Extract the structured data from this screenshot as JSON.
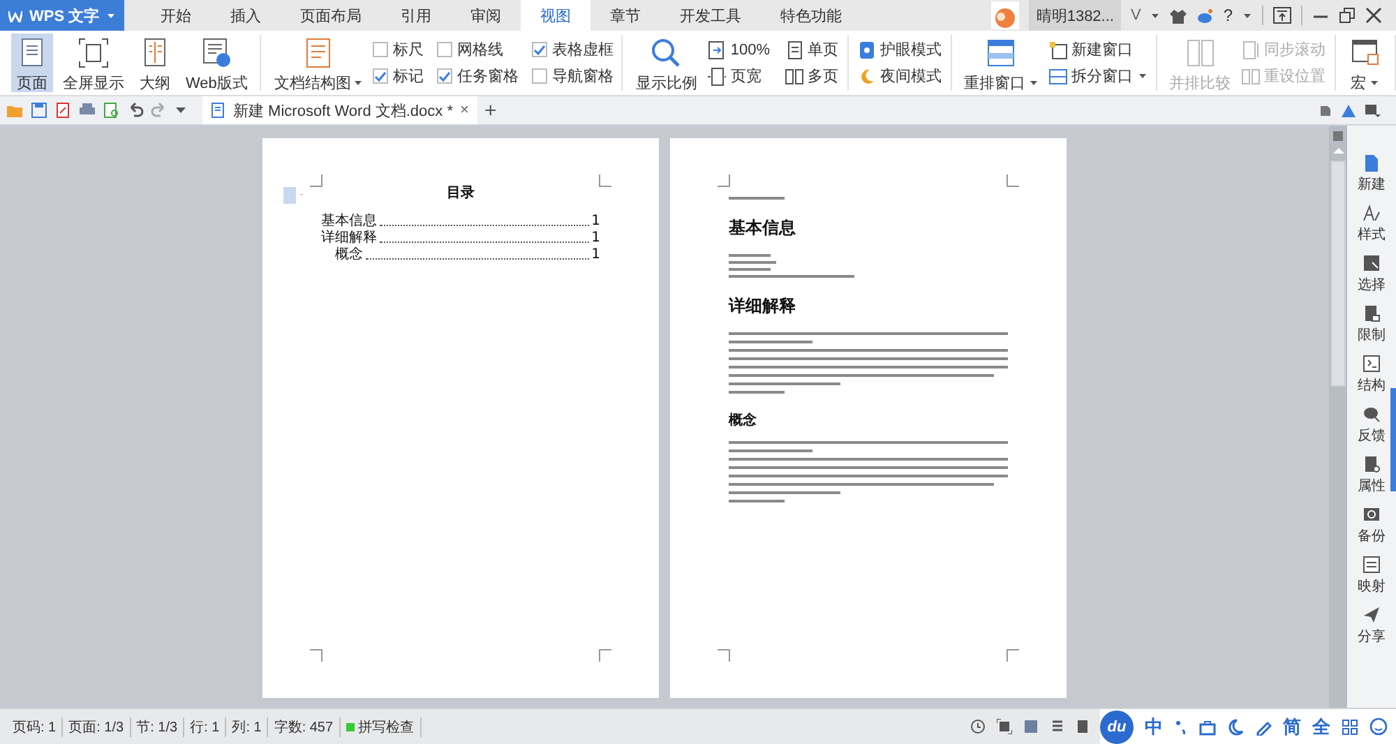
{
  "app_menu": {
    "label": "WPS 文字"
  },
  "tabs": [
    {
      "label": "开始",
      "selected": false
    },
    {
      "label": "插入",
      "selected": false
    },
    {
      "label": "页面布局",
      "selected": false
    },
    {
      "label": "引用",
      "selected": false
    },
    {
      "label": "审阅",
      "selected": false
    },
    {
      "label": "视图",
      "selected": true
    },
    {
      "label": "章节",
      "selected": false
    },
    {
      "label": "开发工具",
      "selected": false
    },
    {
      "label": "特色功能",
      "selected": false
    }
  ],
  "user": {
    "name": "晴明1382...",
    "badge": "V",
    "help": "?"
  },
  "ribbon": {
    "groups": [
      {
        "disabled": false,
        "items": [
          {
            "kind": "large",
            "label": "页面",
            "selected": true
          },
          {
            "kind": "large",
            "label": "全屏显示",
            "selected": false
          },
          {
            "kind": "large",
            "label": "大纲",
            "selected": false
          },
          {
            "kind": "large",
            "label": "Web版式",
            "selected": false
          }
        ]
      },
      {
        "disabled": false,
        "items": [
          {
            "kind": "large",
            "label": "文档结构图",
            "dropdown": true
          },
          {
            "kind": "check",
            "label": "标尺",
            "checked": false
          },
          {
            "kind": "check",
            "label": "标记",
            "checked": true
          },
          {
            "kind": "check",
            "label": "网格线",
            "checked": false
          },
          {
            "kind": "check",
            "label": "任务窗格",
            "checked": true
          },
          {
            "kind": "check",
            "label": "表格虚框",
            "checked": true
          },
          {
            "kind": "check",
            "label": "导航窗格",
            "checked": false
          }
        ]
      },
      {
        "disabled": false,
        "items": [
          {
            "kind": "large",
            "label": "显示比例"
          },
          {
            "kind": "small",
            "label": "100%"
          },
          {
            "kind": "small",
            "label": "页宽"
          },
          {
            "kind": "small",
            "label": "单页"
          },
          {
            "kind": "small",
            "label": "多页"
          }
        ]
      },
      {
        "disabled": false,
        "items": [
          {
            "kind": "small",
            "label": "护眼模式"
          },
          {
            "kind": "small",
            "label": "夜间模式"
          }
        ]
      },
      {
        "disabled": false,
        "items": [
          {
            "kind": "large",
            "label": "重排窗口",
            "dropdown": true
          },
          {
            "kind": "small",
            "label": "新建窗口"
          },
          {
            "kind": "small",
            "label": "拆分窗口",
            "dropdown": true
          }
        ]
      },
      {
        "disabled": true,
        "items": [
          {
            "kind": "large",
            "label": "并排比较"
          },
          {
            "kind": "small",
            "label": "同步滚动"
          },
          {
            "kind": "small",
            "label": "重设位置"
          }
        ]
      },
      {
        "disabled": false,
        "items": [
          {
            "kind": "large",
            "label": "宏",
            "dropdown": true
          }
        ]
      }
    ]
  },
  "document_tab": {
    "title": "新建 Microsoft Word 文档.docx *",
    "close": "×",
    "new_tab": "+"
  },
  "pages": [
    {
      "kind": "toc",
      "title": "目录",
      "entries": [
        {
          "text": "基本信息",
          "page": "1"
        },
        {
          "text": "详细解释",
          "page": "1",
          "children": [
            {
              "text": "概念",
              "page": "1"
            }
          ]
        }
      ]
    },
    {
      "kind": "body",
      "blocks": [
        {
          "kind": "caption"
        },
        {
          "kind": "heading",
          "text": "基本信息"
        },
        {
          "kind": "list"
        },
        {
          "kind": "heading",
          "text": "详细解释"
        },
        {
          "kind": "paragraph"
        },
        {
          "kind": "subheading",
          "text": "概念"
        },
        {
          "kind": "paragraph"
        }
      ]
    }
  ],
  "task_pane": {
    "items": [
      {
        "label": "新建"
      },
      {
        "label": "样式"
      },
      {
        "label": "选择"
      },
      {
        "label": "限制"
      },
      {
        "label": "结构"
      },
      {
        "label": "反馈"
      },
      {
        "label": "属性"
      },
      {
        "label": "备份"
      },
      {
        "label": "映射"
      },
      {
        "label": "分享"
      }
    ]
  },
  "status_bar": {
    "fields": [
      "页码: 1",
      "页面: 1/3",
      "节: 1/3",
      "行: 1",
      "列: 1",
      "字数: 457"
    ],
    "spell_check": "拼写检查"
  },
  "ime": {
    "logo": "du",
    "keys": [
      "中",
      "简",
      "全"
    ]
  }
}
